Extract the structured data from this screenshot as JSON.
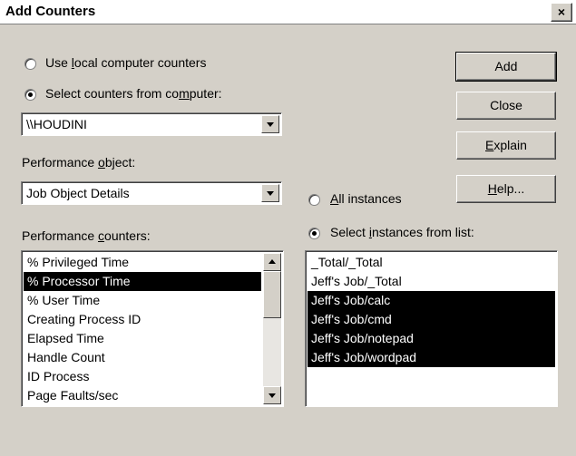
{
  "window": {
    "title": "Add Counters",
    "close_glyph": "×"
  },
  "computer": {
    "local_option_pre": "Use ",
    "local_option_u": "l",
    "local_option_post": "ocal computer counters",
    "local_selected": false,
    "remote_option_pre": "Select counters from co",
    "remote_option_u": "m",
    "remote_option_post": "puter:",
    "remote_selected": true,
    "computer_value": "\\\\HOUDINI"
  },
  "perf_object": {
    "label_pre": "Performance ",
    "label_u": "o",
    "label_post": "bject:",
    "value": "Job Object Details"
  },
  "counters": {
    "label_pre": "Performance ",
    "label_u": "c",
    "label_post": "ounters:",
    "items": [
      {
        "text": "% Privileged Time",
        "selected": false
      },
      {
        "text": "% Processor Time",
        "selected": true
      },
      {
        "text": "% User Time",
        "selected": false
      },
      {
        "text": "Creating Process ID",
        "selected": false
      },
      {
        "text": "Elapsed Time",
        "selected": false
      },
      {
        "text": "Handle Count",
        "selected": false
      },
      {
        "text": "ID Process",
        "selected": false
      },
      {
        "text": "Page Faults/sec",
        "selected": false
      }
    ]
  },
  "instances": {
    "all_u": "A",
    "all_post": "ll instances",
    "all_selected": false,
    "select_pre": "Select ",
    "select_u": "i",
    "select_post": "nstances from list:",
    "select_selected": true,
    "items": [
      {
        "text": "_Total/_Total",
        "selected": false
      },
      {
        "text": "Jeff's Job/_Total",
        "selected": false
      },
      {
        "text": "Jeff's Job/calc",
        "selected": true
      },
      {
        "text": "Jeff's Job/cmd",
        "selected": true
      },
      {
        "text": "Jeff's Job/notepad",
        "selected": true
      },
      {
        "text": "Jeff's Job/wordpad",
        "selected": true
      }
    ]
  },
  "buttons": {
    "add": "Add",
    "close": "Close",
    "explain_u": "E",
    "explain_post": "xplain",
    "help_u": "H",
    "help_post": "elp..."
  },
  "icons": {
    "dropdown": "chevron-down-icon",
    "scroll_up": "scroll-up-arrow-icon",
    "scroll_down": "scroll-down-arrow-icon",
    "radio": "radio-button-icon"
  }
}
